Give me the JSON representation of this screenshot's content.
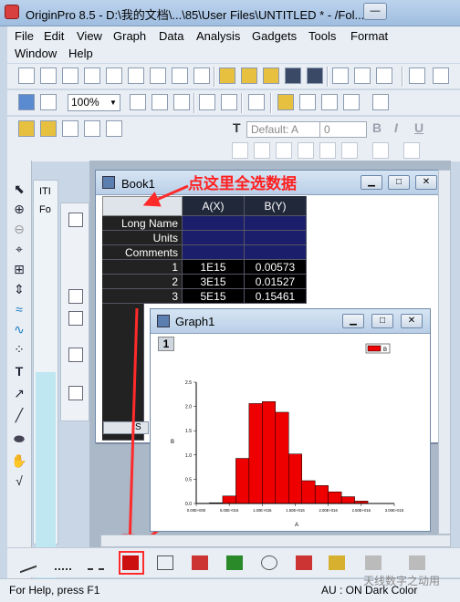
{
  "window": {
    "title": "OriginPro 8.5 - D:\\我的文档\\...\\85\\User Files\\UNTITLED * - /Fol...",
    "minimize_glyph": "—"
  },
  "menus": [
    "File",
    "Edit",
    "View",
    "Graph",
    "Data",
    "Analysis",
    "Gadgets",
    "Tools",
    "Format",
    "Window",
    "Help"
  ],
  "toolbar": {
    "zoom": "100%",
    "font": "Default: A",
    "font_size": "0",
    "bold": "B",
    "italic": "I",
    "underline": "U",
    "text_icon": "T"
  },
  "project_strip": {
    "tab1": "ITI",
    "tab2": "Fo"
  },
  "book": {
    "title": "Book1",
    "columns": [
      "A(X)",
      "B(Y)"
    ],
    "header_rows": [
      "Long Name",
      "Units",
      "Comments"
    ],
    "rows": [
      {
        "index": "1",
        "a": "1E15",
        "b": "0.00573"
      },
      {
        "index": "2",
        "a": "3E15",
        "b": "0.01527"
      },
      {
        "index": "3",
        "a": "5E15",
        "b": "0.15461"
      }
    ],
    "sheet_tab": "S"
  },
  "annotation": "点这里全选数据",
  "graph": {
    "title": "Graph1",
    "layer": "1",
    "legend_label": "B"
  },
  "chart_data": {
    "type": "bar",
    "x": [
      1000000000000000.0,
      3000000000000000.0,
      5000000000000000.0,
      7000000000000000.0,
      9000000000000000.0,
      1.1e+16,
      1.3e+16,
      1.5e+16,
      1.7e+16,
      1.9e+16,
      2.1e+16,
      2.3e+16,
      2.5e+16
    ],
    "values": [
      0.00573,
      0.01527,
      0.15461,
      0.93,
      2.06,
      2.1,
      1.88,
      1.02,
      0.47,
      0.37,
      0.24,
      0.14,
      0.05
    ],
    "ylim": [
      0,
      2.5
    ],
    "xlim": [
      0,
      3e+16
    ],
    "yticks": [
      "0.0",
      "0.5",
      "1.0",
      "1.5",
      "2.0",
      "2.5"
    ],
    "xticks": [
      "0.00E+000",
      "5.00E+015",
      "1.00E+016",
      "1.50E+016",
      "2.00E+016",
      "2.50E+016",
      "3.00E+016"
    ],
    "xlabel": "A",
    "ylabel": "B",
    "bar_color": "#ee0000",
    "legend": "top-right"
  },
  "statusbar": {
    "help": "For Help, press F1",
    "right": "AU : ON   Dark Color",
    "watermark": "天线数字之动用"
  }
}
